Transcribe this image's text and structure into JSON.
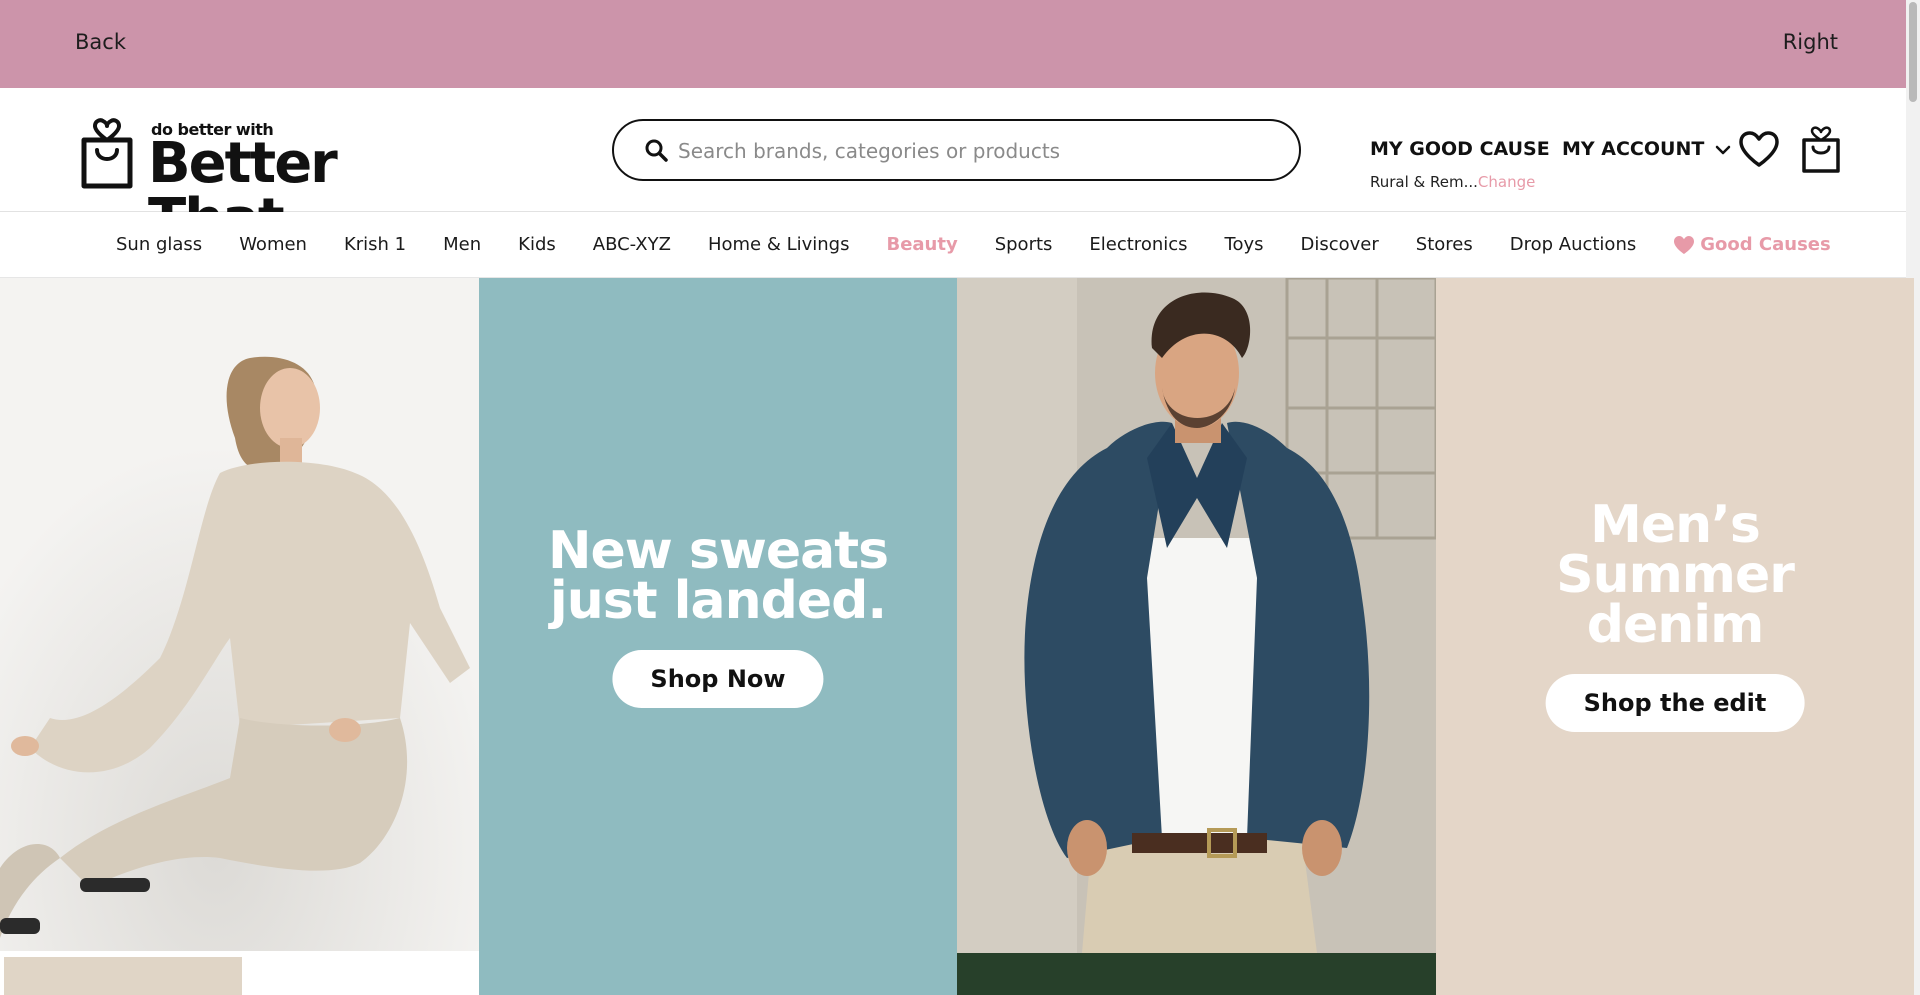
{
  "topbar": {
    "back_label": "Back",
    "right_label": "Right",
    "bg_color": "#cc94aa"
  },
  "logo": {
    "tagline": "do better with",
    "wordmark": "Better That."
  },
  "search": {
    "placeholder": "Search brands, categories or products",
    "value": ""
  },
  "header": {
    "good_cause_label": "MY GOOD CAUSE",
    "cause_name": "Rural & Rem...",
    "cause_change": "Change",
    "account_label": "MY ACCOUNT"
  },
  "nav": {
    "items": [
      {
        "label": "Sun glass"
      },
      {
        "label": "Women"
      },
      {
        "label": "Krish 1"
      },
      {
        "label": "Men"
      },
      {
        "label": "Kids"
      },
      {
        "label": "ABC-XYZ"
      },
      {
        "label": "Home & Livings"
      },
      {
        "label": "Beauty",
        "highlight": true
      },
      {
        "label": "Sports"
      },
      {
        "label": "Electronics"
      },
      {
        "label": "Toys"
      },
      {
        "label": "Discover"
      },
      {
        "label": "Stores"
      },
      {
        "label": "Drop Auctions"
      },
      {
        "label": "Good Causes",
        "highlight": true
      }
    ],
    "accent_color": "#e79aa8"
  },
  "hero": {
    "promo1": {
      "line1": "New sweats",
      "line2": "just landed.",
      "cta": "Shop Now",
      "bg_color": "#8fbbc0"
    },
    "promo2": {
      "line1": "Men’s",
      "line2": "Summer",
      "line3": "denim",
      "cta": "Shop the edit",
      "bg_color": "#e4d6c8"
    }
  }
}
